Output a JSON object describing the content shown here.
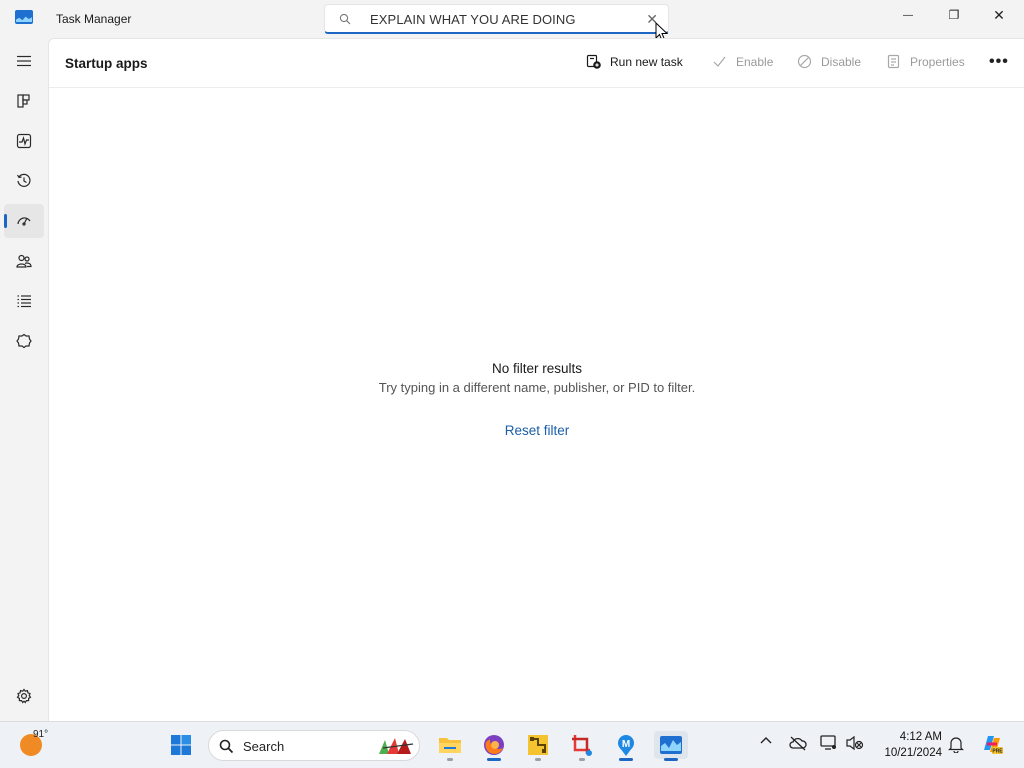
{
  "window": {
    "title": "Task Manager",
    "search_value": "EXPLAIN WHAT YOU ARE DOING",
    "clear_glyph": "✕",
    "minimize_glyph": "—",
    "restore_glyph": "❐",
    "close_glyph": "✕"
  },
  "sidebar": {
    "items": [
      {
        "icon": "hamburger-menu-icon"
      },
      {
        "icon": "processes-icon"
      },
      {
        "icon": "performance-icon"
      },
      {
        "icon": "app-history-icon"
      },
      {
        "icon": "startup-apps-icon",
        "active": true
      },
      {
        "icon": "users-icon"
      },
      {
        "icon": "details-icon"
      },
      {
        "icon": "services-icon"
      }
    ],
    "settings_icon": "gear-icon"
  },
  "page": {
    "title": "Startup apps",
    "toolbar": {
      "run_new_task": "Run new task",
      "enable": "Enable",
      "disable": "Disable",
      "properties": "Properties",
      "more": "•••"
    },
    "empty_state": {
      "title": "No filter results",
      "subtitle": "Try typing in a different name, publisher, or PID to filter.",
      "reset": "Reset filter"
    }
  },
  "taskbar": {
    "weather_temp": "91°",
    "search_label": "Search",
    "clock_time": "4:12 AM",
    "clock_date": "10/21/2024",
    "tray_arrow": "^"
  },
  "colors": {
    "accent": "#1e66c4",
    "link": "#1a5fa8",
    "background": "#f3f3f3",
    "panel": "#ffffff"
  }
}
